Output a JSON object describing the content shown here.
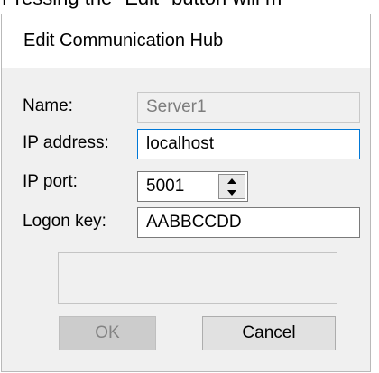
{
  "caption": "Pressing the \"Edit\" button will m",
  "dialog": {
    "title": "Edit Communication Hub",
    "fields": {
      "name_label": "Name:",
      "name_value": "Server1",
      "ip_address_label": "IP address:",
      "ip_address_value": "localhost",
      "ip_port_label": "IP port:",
      "ip_port_value": "5001",
      "logon_key_label": "Logon key:",
      "logon_key_value": "AABBCCDD"
    },
    "status_text": "",
    "buttons": {
      "ok_label": "OK",
      "cancel_label": "Cancel"
    }
  },
  "icons": {
    "stepper_up": "triangle-up-icon",
    "stepper_down": "triangle-down-icon"
  },
  "colors": {
    "dialog_background": "#f0f0f0",
    "focus_border": "#0078d7",
    "disabled_text": "#7d7d7d"
  }
}
